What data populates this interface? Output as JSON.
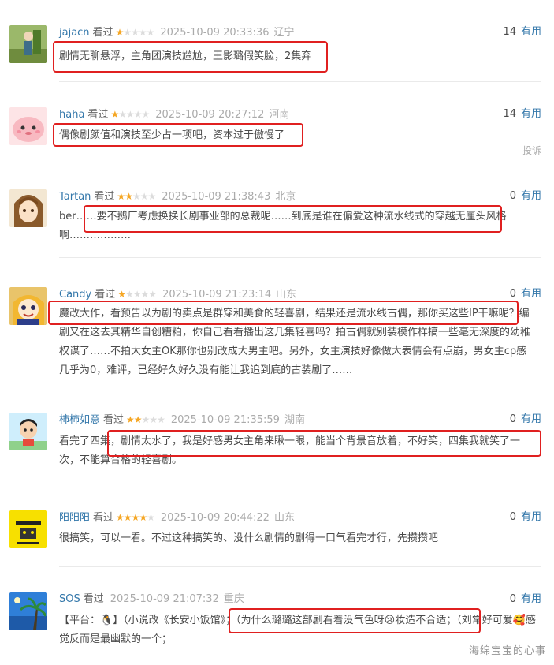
{
  "watched_label": "看过",
  "useful_label": "有用",
  "comments": [
    {
      "user": "jajacn",
      "stars": 1,
      "time": "2025-10-09 20:33:36",
      "location": "辽宁",
      "votes": "14",
      "text": "剧情无聊悬浮，主角团演技尴尬，王影璐假笑脸，2集弃"
    },
    {
      "user": "haha",
      "stars": 1,
      "time": "2025-10-09 20:27:12",
      "location": "河南",
      "votes": "14",
      "text": "偶像剧颜值和演技至少占一项吧，资本过于傲慢了",
      "report": "投诉"
    },
    {
      "user": "Tartan",
      "stars": 2,
      "time": "2025-10-09 21:38:43",
      "location": "北京",
      "votes": "0",
      "text": "ber……要不鹅厂考虑换换长剧事业部的总裁呢……到底是谁在偏爱这种流水线式的穿越无厘头风格啊………………"
    },
    {
      "user": "Candy",
      "stars": 1,
      "time": "2025-10-09 21:23:14",
      "location": "山东",
      "votes": "0",
      "text": "魔改大作，看预告以为剧的卖点是群穿和美食的轻喜剧，结果还是流水线古偶，那你买这些IP干嘛呢？编剧又在这去其精华自创糟粕，你自己看看播出这几集轻喜吗？拍古偶就别装模作样搞一些毫无深度的幼稚权谋了……不拍大女主OK那你也别改成大男主吧。另外，女主演技好像做大表情会有点崩，男女主cp感几乎为0，难评，已经好久好久没有能让我追到底的古装剧了……"
    },
    {
      "user": "柿柿如意",
      "stars": 2,
      "time": "2025-10-09 21:35:59",
      "location": "湖南",
      "votes": "0",
      "text": "看完了四集，剧情太水了，我是好感男女主角来瞅一眼，能当个背景音放着，不好笑，四集我就笑了一次，不能算合格的轻喜剧。"
    },
    {
      "user": "阳阳阳",
      "stars": 4,
      "time": "2025-10-09 20:44:22",
      "location": "山东",
      "votes": "0",
      "text": "很搞笑，可以一看。不过这种搞笑的、没什么剧情的剧得一口气看完才行，先攒攒吧"
    },
    {
      "user": "SOS",
      "stars": 0,
      "time": "2025-10-09 21:07:32",
      "location": "重庆",
      "votes": "0",
      "text": "【平台：🐧】（小说改《长安小饭馆》；（为什么璐璐这部剧看着没气色呀😢妆造不合适；（刘常好可爱🥰感觉反而是最幽默的一个；"
    }
  ],
  "watermark": "海绵宝宝的心事",
  "colors": {
    "link": "#3377aa",
    "star": "#f5a623",
    "highlight": "#e02020",
    "meta": "#aaaaaa"
  }
}
